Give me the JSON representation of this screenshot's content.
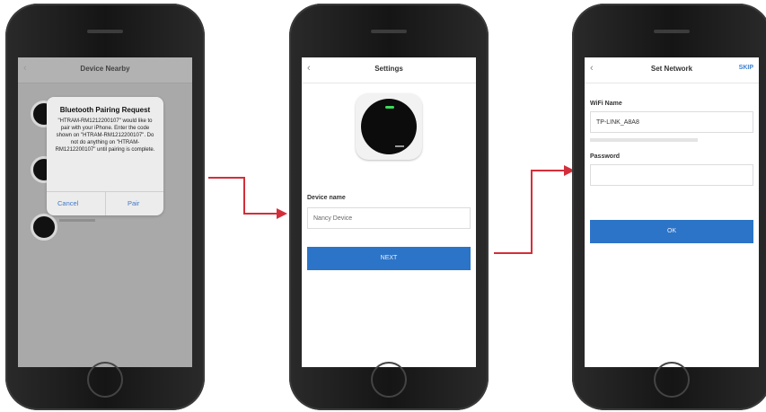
{
  "phone1": {
    "title": "Device Nearby",
    "dialog": {
      "title": "Bluetooth Pairing Request",
      "message": "\"HTRAM-RM1212200107\" would like to pair with your iPhone. Enter the code shown on \"HTRAM-RM1212200107\". Do not do anything on \"HTRAM-RM1212200107\" until pairing is complete.",
      "cancel": "Cancel",
      "pair": "Pair"
    }
  },
  "phone2": {
    "title": "Settings",
    "device_name_label": "Device name",
    "device_name_value": "Nancy Device",
    "next_button": "NEXT"
  },
  "phone3": {
    "title": "Set Network",
    "skip": "SKIP",
    "wifi_label": "WiFi Name",
    "wifi_value": "TP-LINK_A8A8",
    "password_label": "Password",
    "password_value": "",
    "ok_button": "OK"
  },
  "colors": {
    "accent": "#2c74c7",
    "arrow": "#d32f3a"
  }
}
